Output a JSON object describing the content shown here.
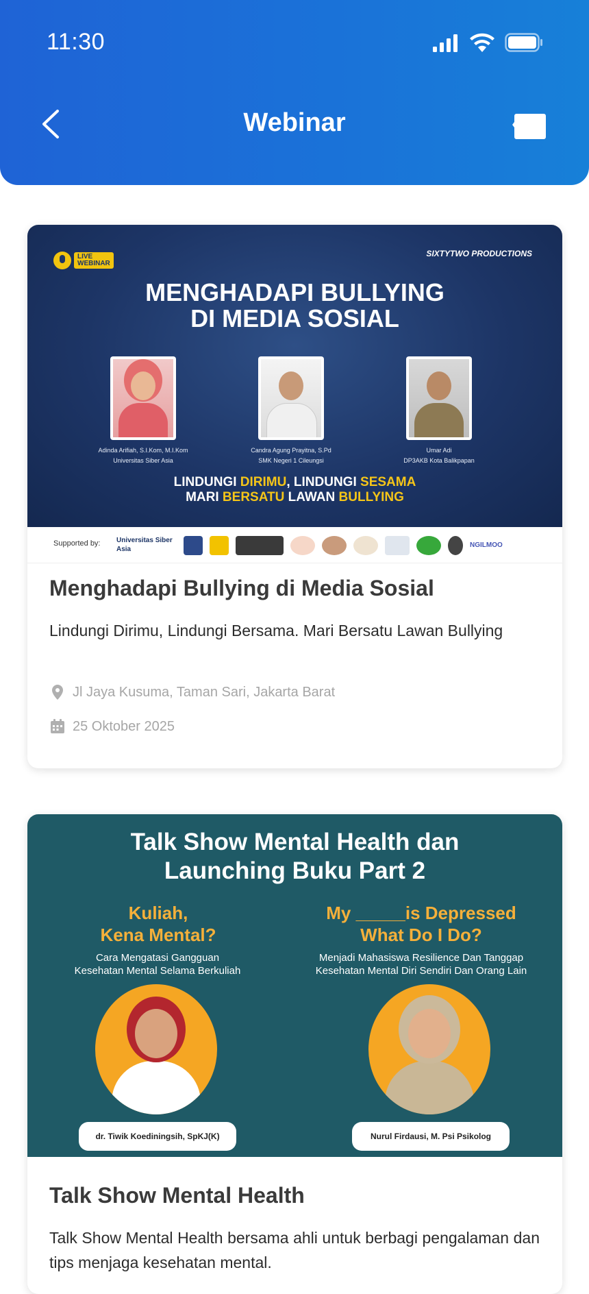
{
  "status_bar": {
    "time": "11:30"
  },
  "header": {
    "title": "Webinar"
  },
  "events": [
    {
      "banner": {
        "live_tag_1": "LIVE",
        "live_tag_2": "WEBINAR",
        "producer": "SIXTYTWO PRODUCTIONS",
        "title_line1": "MENGHADAPI BULLYING",
        "title_line2": "DI MEDIA SOSIAL",
        "speakers": [
          {
            "name": "Adinda Arifiah, S.I.Kom, M.I.Kom",
            "org": "Universitas Siber Asia"
          },
          {
            "name": "Candra Agung Prayitna, S.Pd",
            "org": "SMK Negeri 1 Cileungsi"
          },
          {
            "name": "Umar Adi",
            "org": "DP3AKB Kota Balikpapan"
          }
        ],
        "slogan_line1_a": "LINDUNGI ",
        "slogan_line1_b": "DIRIMU",
        "slogan_line1_c": ", LINDUNGI ",
        "slogan_line1_d": "SESAMA",
        "slogan_line2_a": "MARI ",
        "slogan_line2_b": "BERSATU",
        "slogan_line2_c": " LAWAN ",
        "slogan_line2_d": "BULLYING",
        "supported_by": "Supported by:",
        "sponsor_1": "Universitas Siber Asia",
        "sponsor_last": "NGILMOO"
      },
      "title": "Menghadapi Bullying di Media Sosial",
      "description": "Lindungi Dirimu, Lindungi Bersama. Mari Bersatu Lawan Bullying",
      "location": "Jl Jaya Kusuma, Taman Sari, Jakarta Barat",
      "date": "25 Oktober 2025"
    },
    {
      "banner": {
        "title_line1": "Talk Show Mental Health dan",
        "title_line2": "Launching Buku Part 2",
        "left_head_1": "Kuliah,",
        "left_head_2": "Kena Mental?",
        "left_sub_1": "Cara Mengatasi Gangguan",
        "left_sub_2": "Kesehatan Mental Selama Berkuliah",
        "right_head_1": "My _____is Depressed",
        "right_head_2": "What Do I Do?",
        "right_sub_1": "Menjadi Mahasiswa Resilience Dan Tanggap",
        "right_sub_2": "Kesehatan Mental Diri Sendiri Dan Orang Lain",
        "left_speaker": "dr. Tiwik Koediningsih, SpKJ(K)",
        "right_speaker": "Nurul Firdausi, M. Psi Psikolog"
      },
      "title": "Talk Show Mental Health",
      "description": "Talk Show Mental Health bersama ahli untuk berbagi pengalaman dan tips menjaga kesehatan mental."
    }
  ],
  "colors": {
    "header": "#1f63d6",
    "accent_yellow": "#f5c518",
    "banner2_bg": "#1f5a66"
  },
  "icons": [
    "back-arrow-icon",
    "chat-icon",
    "location-pin-icon",
    "calendar-icon",
    "signal-icon",
    "wifi-icon",
    "battery-icon"
  ]
}
